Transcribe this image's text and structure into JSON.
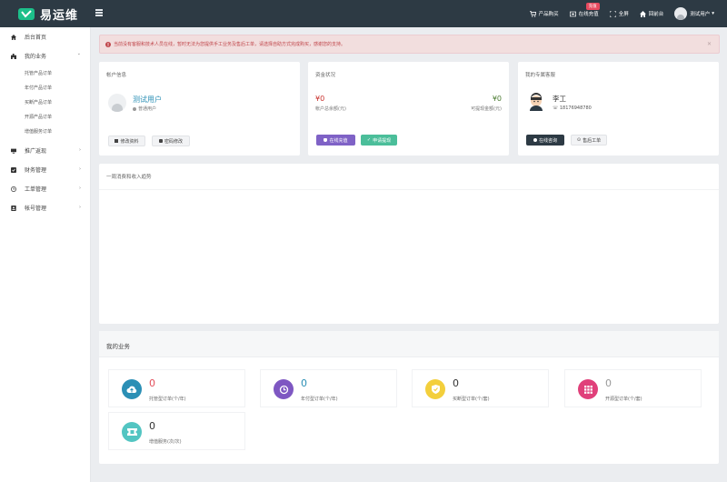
{
  "topbar": {
    "logo_text": "易运维",
    "items": [
      {
        "label": "产品购买",
        "icon": "cart-icon"
      },
      {
        "label": "在线充值",
        "icon": "wallet-icon",
        "badge": "充值"
      },
      {
        "label": "全屏",
        "icon": "fullscreen-icon"
      },
      {
        "label": "回前台",
        "icon": "home-icon"
      }
    ],
    "user_label": "测试用户",
    "user_caret": "▾"
  },
  "sidebar": {
    "items": [
      {
        "label": "后台首页",
        "icon": "home-icon"
      },
      {
        "label": "我的业务",
        "icon": "puzzle-icon",
        "chevron": "⌄"
      },
      {
        "label": "推广返现",
        "icon": "monitor-icon",
        "chevron": "›"
      },
      {
        "label": "财务管理",
        "icon": "check-square-icon",
        "chevron": "›"
      },
      {
        "label": "工单管理",
        "icon": "clock-icon",
        "chevron": "›"
      },
      {
        "label": "帐号管理",
        "icon": "id-card-icon",
        "chevron": "›"
      }
    ],
    "sub_items": [
      "托管产品订单",
      "年付产品订单",
      "买断产品订单",
      "开源产品订单",
      "增值服务订单"
    ]
  },
  "alert": {
    "text": "当前没有客服和技术人员在线，暂时无法为您提供手工业务及售后工单，请选择自助方式完成购买，感谢您的支持。",
    "close": "✕"
  },
  "account": {
    "title": "帐户信息",
    "user_name": "测试用户",
    "user_type": "普通用户",
    "edit_btn": "修改资料",
    "password_btn": "密码修改"
  },
  "funds": {
    "title": "资金状况",
    "balance": "¥0",
    "balance_label": "帐户总余额(元)",
    "withdrawable": "¥0",
    "withdrawable_label": "可提现金额(元)",
    "recharge_btn": "在线充值",
    "withdraw_btn": "申请提现"
  },
  "service": {
    "title": "我的专属客服",
    "name": "李工",
    "phone": "18176948780",
    "consult_btn": "在线咨询",
    "ticket_btn": "售后工单"
  },
  "trend": {
    "title": "一周消费和收入趋势"
  },
  "business": {
    "title": "我的业务",
    "items": [
      {
        "value": "0",
        "label": "托管型订单(个/年)",
        "icon": "cloud-upload-icon",
        "color": "#2b8fb5",
        "value_color": "#e34f5b"
      },
      {
        "value": "0",
        "label": "年付型订单(个/年)",
        "icon": "history-icon",
        "color": "#7e57c2",
        "value_color": "#2b8fb5"
      },
      {
        "value": "0",
        "label": "买断型订单(个/套)",
        "icon": "shield-check-icon",
        "color": "#f3cf3c",
        "value_color": "#333333"
      },
      {
        "value": "0",
        "label": "开源型订单(个/套)",
        "icon": "grid-icon",
        "color": "#e0407a",
        "value_color": "#999999"
      },
      {
        "value": "0",
        "label": "增值服务(次/次)",
        "icon": "ticket-icon",
        "color": "#53c5c2",
        "value_color": "#333333"
      }
    ]
  }
}
